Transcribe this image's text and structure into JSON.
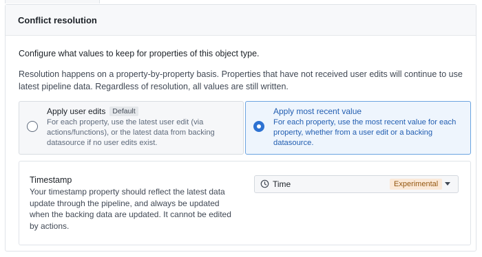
{
  "header": {
    "title": "Conflict resolution"
  },
  "intro": "Configure what values to keep for properties of this object type.",
  "description": "Resolution happens on a property-by-property basis. Properties that have not received user edits will continue to use latest pipeline data. Regardless of resolution, all values are still written.",
  "options": [
    {
      "title": "Apply user edits",
      "badge": "Default",
      "body": "For each property, use the latest user edit (via actions/functions), or the latest data from backing datasource if no user edits exist.",
      "selected": false
    },
    {
      "title": "Apply most recent value",
      "body": "For each property, use the most recent value for each property, whether from a user edit or a backing datasource.",
      "selected": true
    }
  ],
  "timestamp": {
    "title": "Timestamp",
    "body": "Your timestamp property should reflect the latest data update through the pipeline, and always be updated when the backing data are updated. It cannot be edited by actions.",
    "select_value": "Time",
    "select_icon": "clock-icon",
    "badge": "Experimental"
  },
  "colors": {
    "accent": "#2d72d2",
    "selected_bg": "#eef5fd",
    "experimental_bg": "#fbe9d8",
    "experimental_text": "#935610"
  }
}
